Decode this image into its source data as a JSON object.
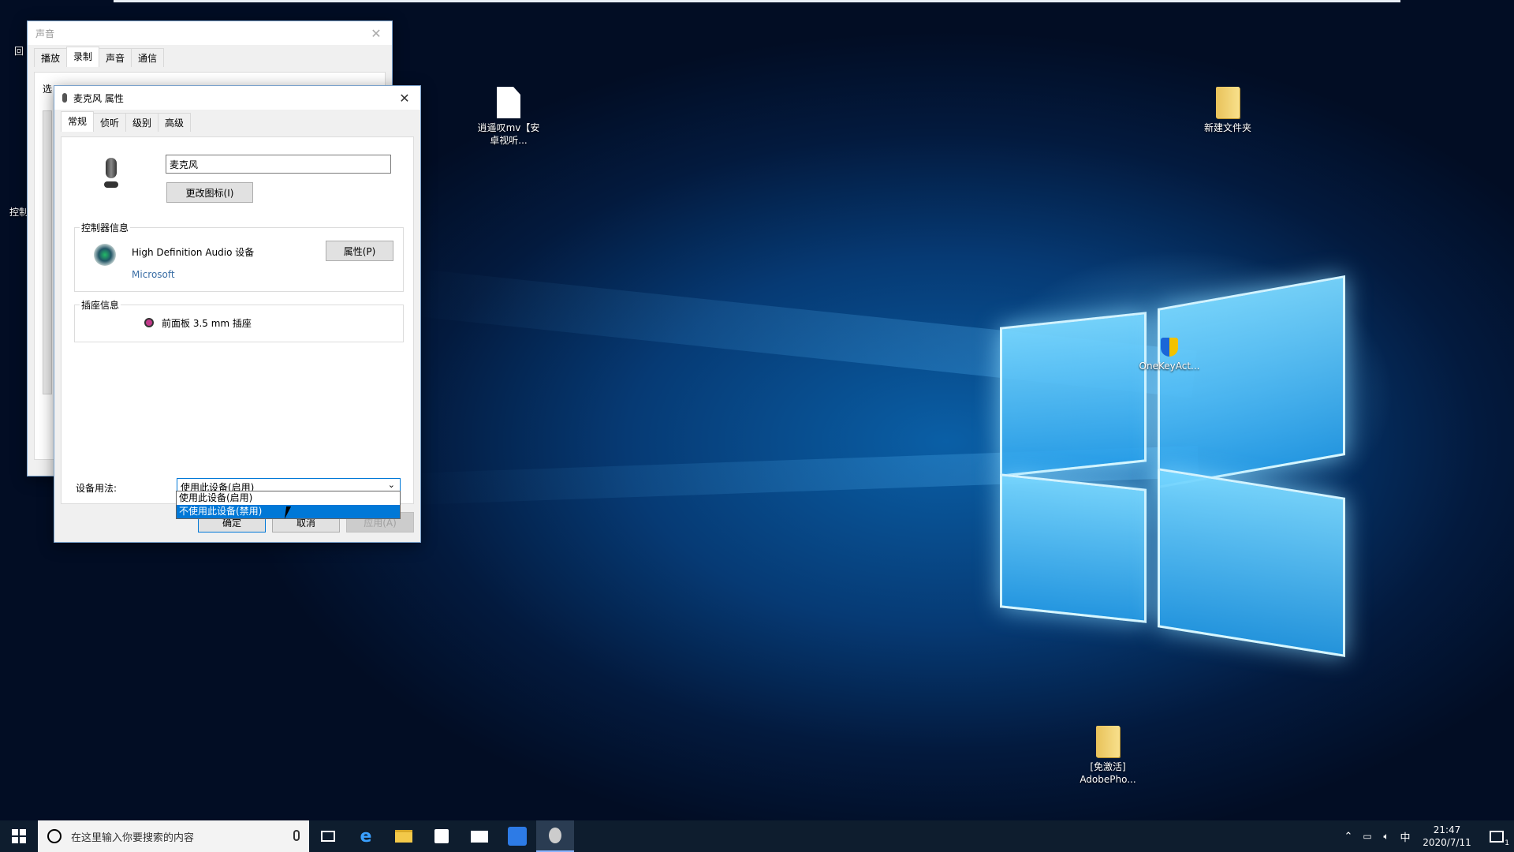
{
  "desktop": {
    "icons": [
      {
        "label": "逍遥叹mv【安卓视听...",
        "icon": "file-icon"
      },
      {
        "label": "新建文件夹",
        "icon": "folder-icon"
      },
      {
        "label": "OneKeyAct...",
        "icon": "shield-icon"
      },
      {
        "label": "[免激活] AdobePho...",
        "icon": "folder-icon"
      }
    ],
    "left_partial": [
      "回",
      "控制"
    ]
  },
  "sound_window": {
    "title": "声音",
    "tabs": [
      "播放",
      "录制",
      "声音",
      "通信"
    ],
    "active_tab": "录制",
    "partial_text": "选"
  },
  "props_window": {
    "title": "麦克风 属性",
    "tabs": [
      "常规",
      "侦听",
      "级别",
      "高级"
    ],
    "active_tab": "常规",
    "device_name_value": "麦克风",
    "change_icon_label": "更改图标(I)",
    "controller": {
      "group_label": "控制器信息",
      "name": "High Definition Audio 设备",
      "vendor": "Microsoft",
      "properties_label": "属性(P)"
    },
    "jack": {
      "group_label": "插座信息",
      "label": "前面板 3.5 mm 插座"
    },
    "usage": {
      "label": "设备用法:",
      "selected": "使用此设备(启用)",
      "options": [
        "使用此设备(启用)",
        "不使用此设备(禁用)"
      ],
      "highlighted": "不使用此设备(禁用)"
    },
    "buttons": {
      "ok": "确定",
      "cancel": "取消",
      "apply": "应用(A)"
    }
  },
  "taskbar": {
    "search_placeholder": "在这里输入你要搜索的内容",
    "tray": {
      "ime": "中",
      "time": "21:47",
      "date": "2020/7/11",
      "notifications": "1"
    }
  },
  "colors": {
    "accent": "#0078d7",
    "taskbar": "#0e1d2e",
    "selected": "#0078d7"
  }
}
